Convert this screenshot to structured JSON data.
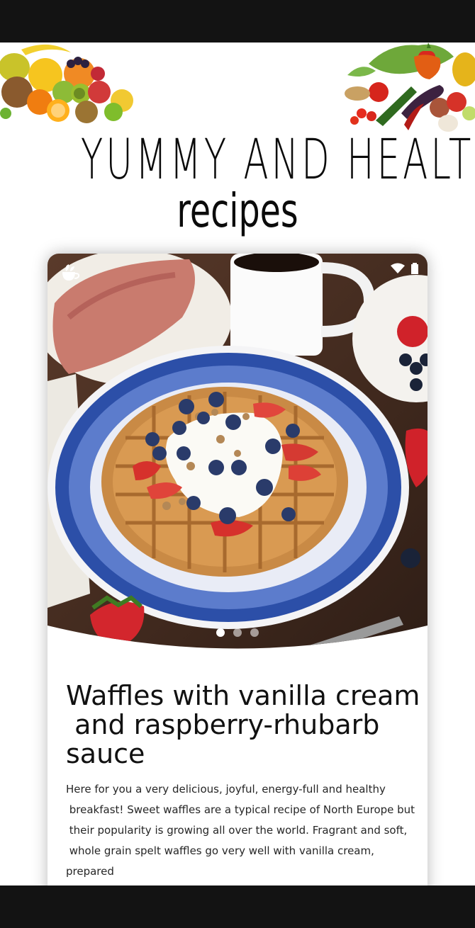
{
  "header": {
    "title": "YUMMY AND HEALTHY",
    "subtitle": "recipes"
  },
  "status_bar": {
    "app_icon": "teacup-icon",
    "wifi_icon": "wifi-icon",
    "battery_icon": "battery-icon"
  },
  "carousel": {
    "total": 3,
    "active": 1,
    "image": "waffles-photo"
  },
  "recipe": {
    "title": "Waffles with vanilla cream\n and raspberry-rhubarb\nsauce",
    "description": "Here for you a very delicious, joyful, energy-full and healthy\n breakfast! Sweet waffles are a typical recipe of North Europe but\n their popularity is growing all over the world. Fragrant and soft,\n whole grain spelt waffles go very well with vanilla cream, prepared\n with plant based milk and unrefined sugar, and raspberry and"
  },
  "colors": {
    "plate_blue": "#2c4fa8",
    "waffle": "#c98a45",
    "table_wood": "#4a3124",
    "text": "#111111"
  }
}
